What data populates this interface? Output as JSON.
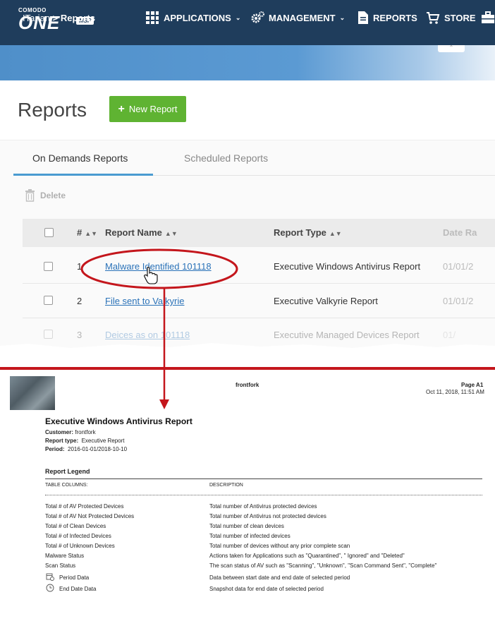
{
  "logo": {
    "small": "COMODO",
    "one": "ONE",
    "msp": "MSP"
  },
  "nav": {
    "applications": "APPLICATIONS",
    "management": "MANAGEMENT",
    "reports": "REPORTS",
    "store": "STORE"
  },
  "breadcrumb": {
    "root": "ITarian",
    "separator": ">",
    "current": "Reports"
  },
  "page": {
    "title": "Reports",
    "new_report": "New Report"
  },
  "tabs": [
    {
      "label": "On Demands Reports",
      "active": true
    },
    {
      "label": "Scheduled Reports",
      "active": false
    }
  ],
  "toolbar": {
    "delete": "Delete"
  },
  "table": {
    "headers": {
      "num": "#",
      "name": "Report Name",
      "type": "Report Type",
      "date": "Date Ra"
    },
    "rows": [
      {
        "num": "1",
        "name": "Malware Identified 101118",
        "type": "Executive Windows Antivirus Report",
        "date": "01/01/2"
      },
      {
        "num": "2",
        "name": "File sent to Valkyrie",
        "type": "Executive Valkyrie Report",
        "date": "01/01/2"
      },
      {
        "num": "3",
        "name": "Deices as on 101118",
        "type": "Executive Managed Devices Report",
        "date": "01/"
      }
    ]
  },
  "report": {
    "company": "frontfork",
    "page": "Page A1",
    "timestamp": "Oct 11, 2018, 11:51 AM",
    "title": "Executive Windows Antivirus Report",
    "customer_label": "Customer:",
    "customer": "frontfork",
    "type_label": "Report type:",
    "type": "Executive Report",
    "period_label": "Period:",
    "period": "2016-01-01/2018-10-10",
    "legend_title": "Report Legend",
    "col_header": "TABLE COLUMNS:",
    "desc_header": "DESCRIPTION",
    "legend": [
      {
        "col": "Total # of AV Protected Devices",
        "desc": "Total number of Antivirus protected devices"
      },
      {
        "col": "Total # of AV Not Protected Devices",
        "desc": "Total number of Antivirus not protected devices"
      },
      {
        "col": "Total # of Clean Devices",
        "desc": "Total number of clean devices"
      },
      {
        "col": "Total # of Infected Devices",
        "desc": "Total number of infected devices"
      },
      {
        "col": "Total # of Unknown Devices",
        "desc": "Total number of devices without any prior complete scan"
      },
      {
        "col": "Malware Status",
        "desc": "Actions taken for Applications such as \"Quarantined\", \" Ignored\" and \"Deleted\""
      },
      {
        "col": "Scan Status",
        "desc": "The scan status of AV such as \"Scanning\", \"Unknown\",  \"Scan Command Sent\", \"Complete\""
      }
    ],
    "period_data": {
      "label": "Period Data",
      "desc": "Data between start date and end date of selected period"
    },
    "end_date_data": {
      "label": "End Date Data",
      "desc": "Snapshot data for end date of selected period"
    }
  },
  "colors": {
    "topbar": "#1f3d5c",
    "accent_green": "#5fb332",
    "link": "#2a72b8",
    "annotation_red": "#c4161c",
    "tab_underline": "#4a9bd1"
  }
}
